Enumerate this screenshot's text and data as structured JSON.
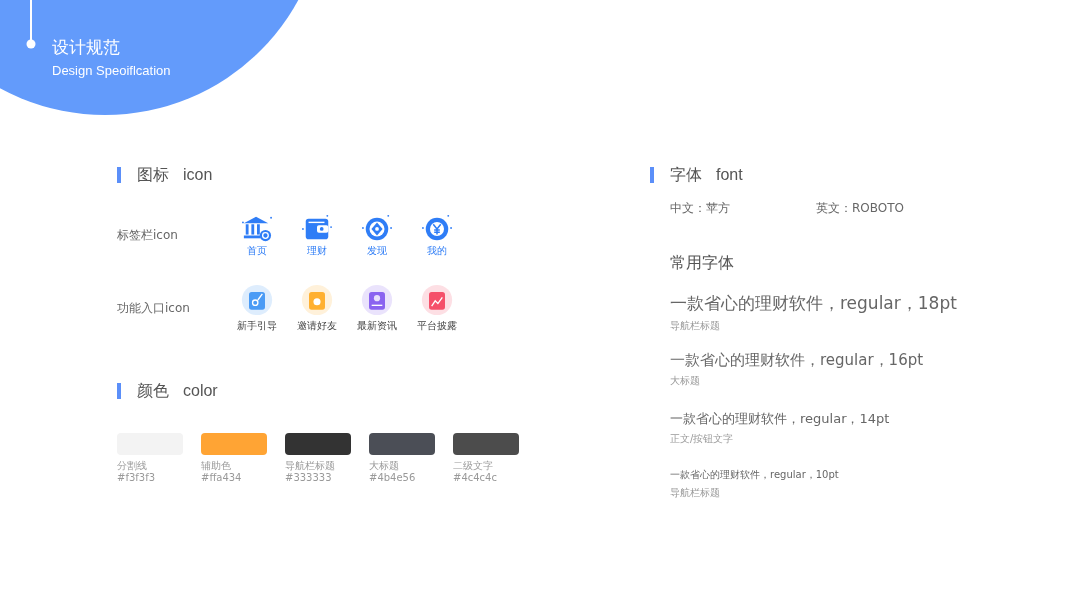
{
  "header": {
    "title": "设计规范",
    "subtitle": "Design Speoiflcation"
  },
  "icon_section": {
    "heading_cn": "图标",
    "heading_en": "icon",
    "tab_bar": {
      "label": "标签栏icon",
      "items": [
        {
          "label": "首页"
        },
        {
          "label": "理财"
        },
        {
          "label": "发现"
        },
        {
          "label": "我的"
        }
      ]
    },
    "entry": {
      "label": "功能入口icon",
      "items": [
        {
          "label": "新手引导",
          "color": "#4a9bf5"
        },
        {
          "label": "邀请好友",
          "color": "#ffb030"
        },
        {
          "label": "最新资讯",
          "color": "#8a63f0"
        },
        {
          "label": "平台披露",
          "color": "#f5506a"
        }
      ]
    }
  },
  "color_section": {
    "heading_cn": "颜色",
    "heading_en": "color",
    "swatches": [
      {
        "name": "分割线",
        "hex": "#f3f3f3",
        "color": "#f3f3f3"
      },
      {
        "name": "辅助色",
        "hex": "#ffa434",
        "color": "#ffa434"
      },
      {
        "name": "导航栏标题",
        "hex": "#333333",
        "color": "#333333"
      },
      {
        "name": "大标题",
        "hex": "#4b4e56",
        "color": "#4b4e56"
      },
      {
        "name": "二级文字",
        "hex": "#4c4c4c",
        "color": "#4c4c4c"
      }
    ]
  },
  "font_section": {
    "heading_cn": "字体",
    "heading_en": "font",
    "chinese": "中文：苹方",
    "english": "英文：ROBOTO",
    "common_heading": "常用字体",
    "samples": [
      {
        "kind": "xl",
        "text": "一款省心的理财软件，regular，18pt",
        "caption": "导航栏标题"
      },
      {
        "kind": "lg",
        "text": "一款省心的理财软件，regular，16pt",
        "caption": "大标题"
      },
      {
        "kind": "md",
        "text": "一款省心的理财软件，regular，14pt",
        "caption": "正文/按钮文字"
      },
      {
        "kind": "sm",
        "text": "一款省心的理财软件，regular，10pt",
        "caption": "导航栏标题"
      }
    ]
  }
}
